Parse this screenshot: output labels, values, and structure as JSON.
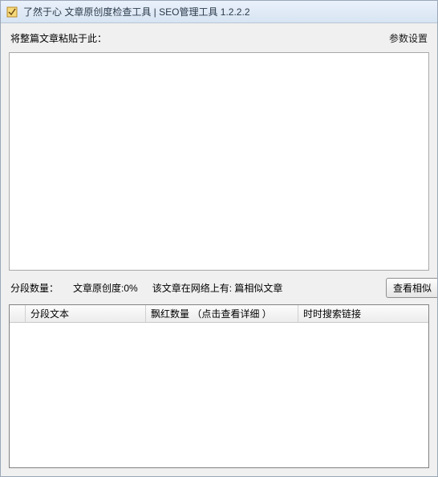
{
  "window": {
    "title": "了然于心 文章原创度检查工具 | SEO管理工具  1.2.2.2"
  },
  "top": {
    "paste_label": "将整篇文章粘贴于此：",
    "settings_label": "参数设置"
  },
  "textarea": {
    "value": "",
    "placeholder": ""
  },
  "stats": {
    "segment_count_label": "分段数量：",
    "segment_count_value": "",
    "originality_label": "文章原创度:",
    "originality_value": "0%",
    "network_label": "该文章在网络上有:",
    "network_value": "篇相似文章",
    "view_similar_button": "查看相似"
  },
  "table": {
    "headers": {
      "segment_text": "分段文本",
      "red_count": "飘红数量 （点击查看详细 ）",
      "search_link": "时时搜索链接"
    }
  }
}
